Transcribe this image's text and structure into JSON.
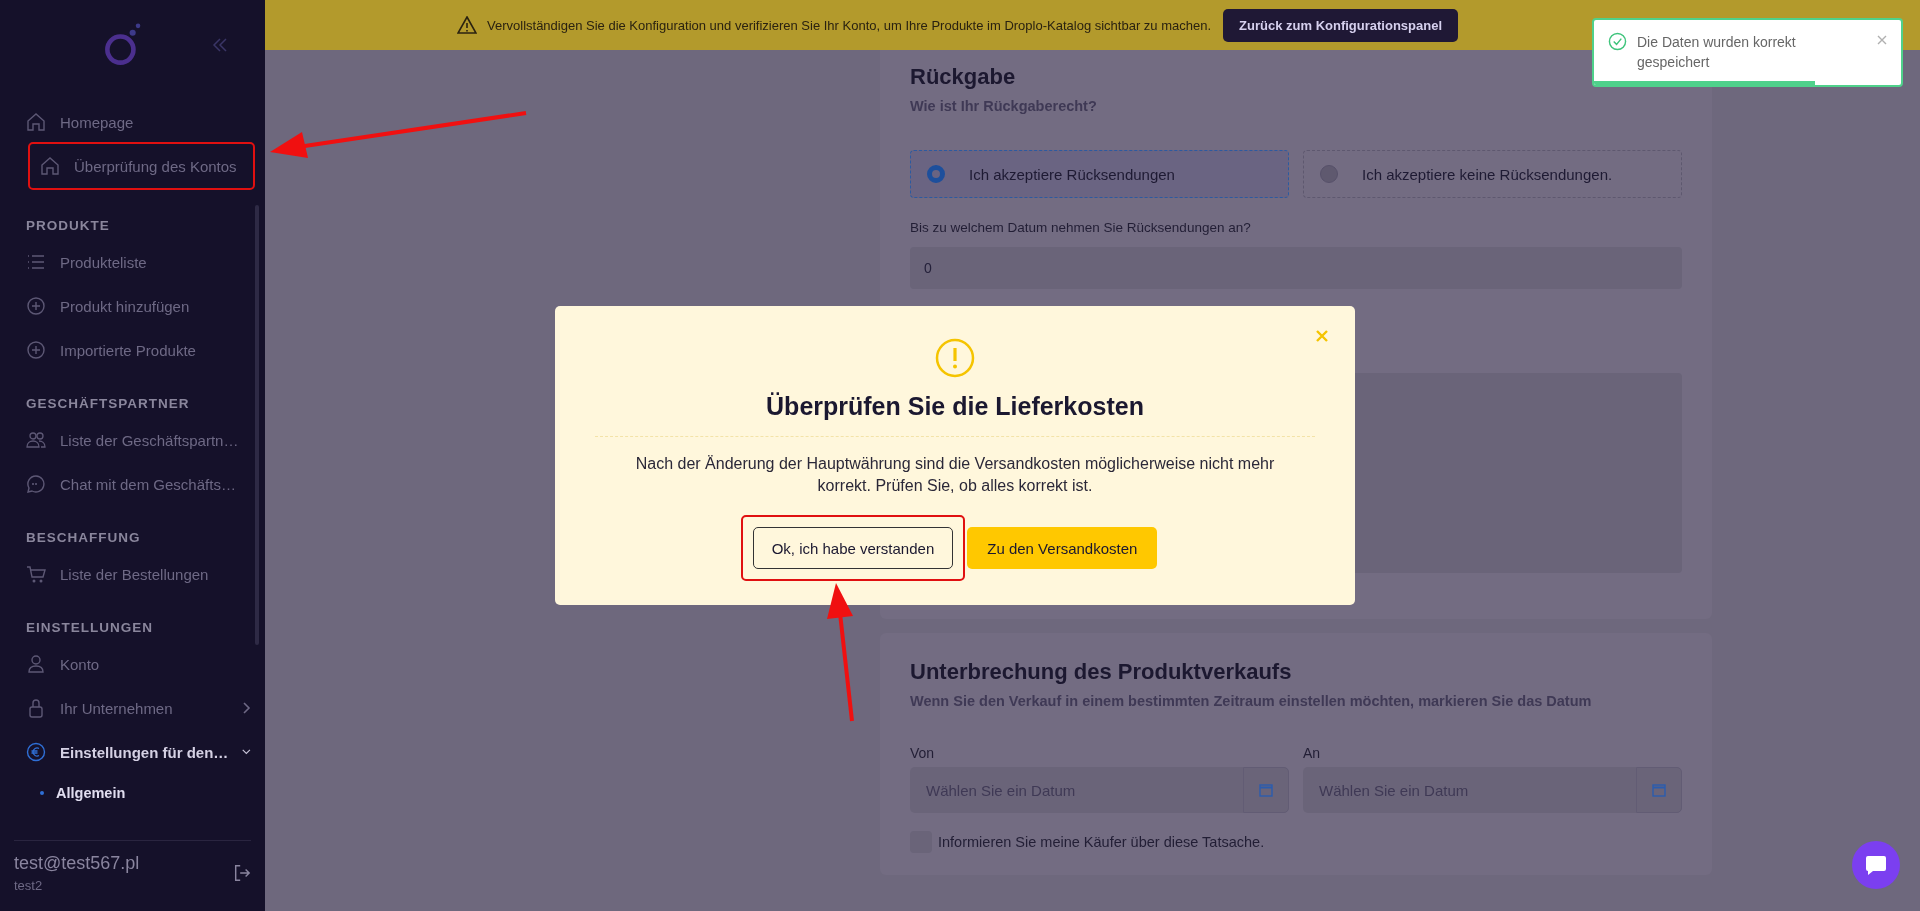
{
  "sidebar": {
    "items": [
      {
        "kind": "link",
        "label": "Homepage",
        "selected": false,
        "annotated": false
      },
      {
        "kind": "link",
        "label": "Überprüfung des Kontos",
        "selected": false,
        "annotated": true
      },
      {
        "kind": "header",
        "label": "PRODUKTE"
      },
      {
        "kind": "link",
        "label": "Produkteliste",
        "selected": false,
        "annotated": false
      },
      {
        "kind": "link",
        "label": "Produkt hinzufügen",
        "selected": false,
        "annotated": false
      },
      {
        "kind": "link",
        "label": "Importierte Produkte",
        "selected": false,
        "annotated": false
      },
      {
        "kind": "header",
        "label": "GESCHÄFTSPARTNER"
      },
      {
        "kind": "link",
        "label": "Liste der Geschäftspartn…",
        "selected": false,
        "annotated": false
      },
      {
        "kind": "link",
        "label": "Chat mit dem Geschäfts…",
        "selected": false,
        "annotated": false
      },
      {
        "kind": "header",
        "label": "BESCHAFFUNG"
      },
      {
        "kind": "link",
        "label": "Liste der Bestellungen",
        "selected": false,
        "annotated": false
      },
      {
        "kind": "header",
        "label": "EINSTELLUNGEN"
      },
      {
        "kind": "link",
        "label": "Konto",
        "selected": false,
        "annotated": false
      },
      {
        "kind": "link",
        "label": "Ihr Unternehmen",
        "selected": false,
        "annotated": false,
        "expanded": false
      },
      {
        "kind": "link",
        "label": "Einstellungen für den…",
        "selected": true,
        "annotated": false,
        "expanded": true,
        "children": [
          {
            "label": "Allgemein",
            "selected": true
          }
        ]
      }
    ],
    "user": {
      "email": "test@test567.pl",
      "name": "test2"
    }
  },
  "banner": {
    "text": "Vervollständigen Sie die Konfiguration und verifizieren Sie Ihr Konto, um Ihre Produkte im Droplo-Katalog sichtbar zu machen.",
    "button": "Zurück zum Konfigurationspanel"
  },
  "returns": {
    "title": "Rückgabe",
    "subtitle": "Wie ist Ihr Rückgaberecht?",
    "options": [
      {
        "label": "Ich akzeptiere Rücksendungen",
        "selected": true
      },
      {
        "label": "Ich akzeptiere keine Rücksendungen.",
        "selected": false
      }
    ],
    "question": "Bis zu welchem Datum nehmen Sie Rücksendungen an?",
    "value": "0"
  },
  "pause": {
    "title": "Unterbrechung des Produktverkaufs",
    "subtitle": "Wenn Sie den Verkauf in einem bestimmten Zeitraum einstellen möchten, markieren Sie das Datum",
    "fields": [
      {
        "label": "Von",
        "placeholder": "Wählen Sie ein Datum"
      },
      {
        "label": "An",
        "placeholder": "Wählen Sie ein Datum"
      }
    ],
    "checkbox": {
      "label": "Informieren Sie meine Käufer über diese Tatsache.",
      "checked": false
    }
  },
  "modal": {
    "title": "Überprüfen Sie die Lieferkosten",
    "text": "Nach der Änderung der Hauptwährung sind die Versandkosten möglicherweise nicht mehr korrekt. Prüfen Sie, ob alles korrekt ist.",
    "buttons": [
      {
        "kind": "secondary",
        "label": "Ok, ich habe verstanden",
        "annotated": true
      },
      {
        "kind": "primary",
        "label": "Zu den Versandkosten",
        "annotated": false
      }
    ]
  },
  "toast": {
    "text": "Die Daten wurden korrekt gespeichert",
    "level": 0.72
  }
}
